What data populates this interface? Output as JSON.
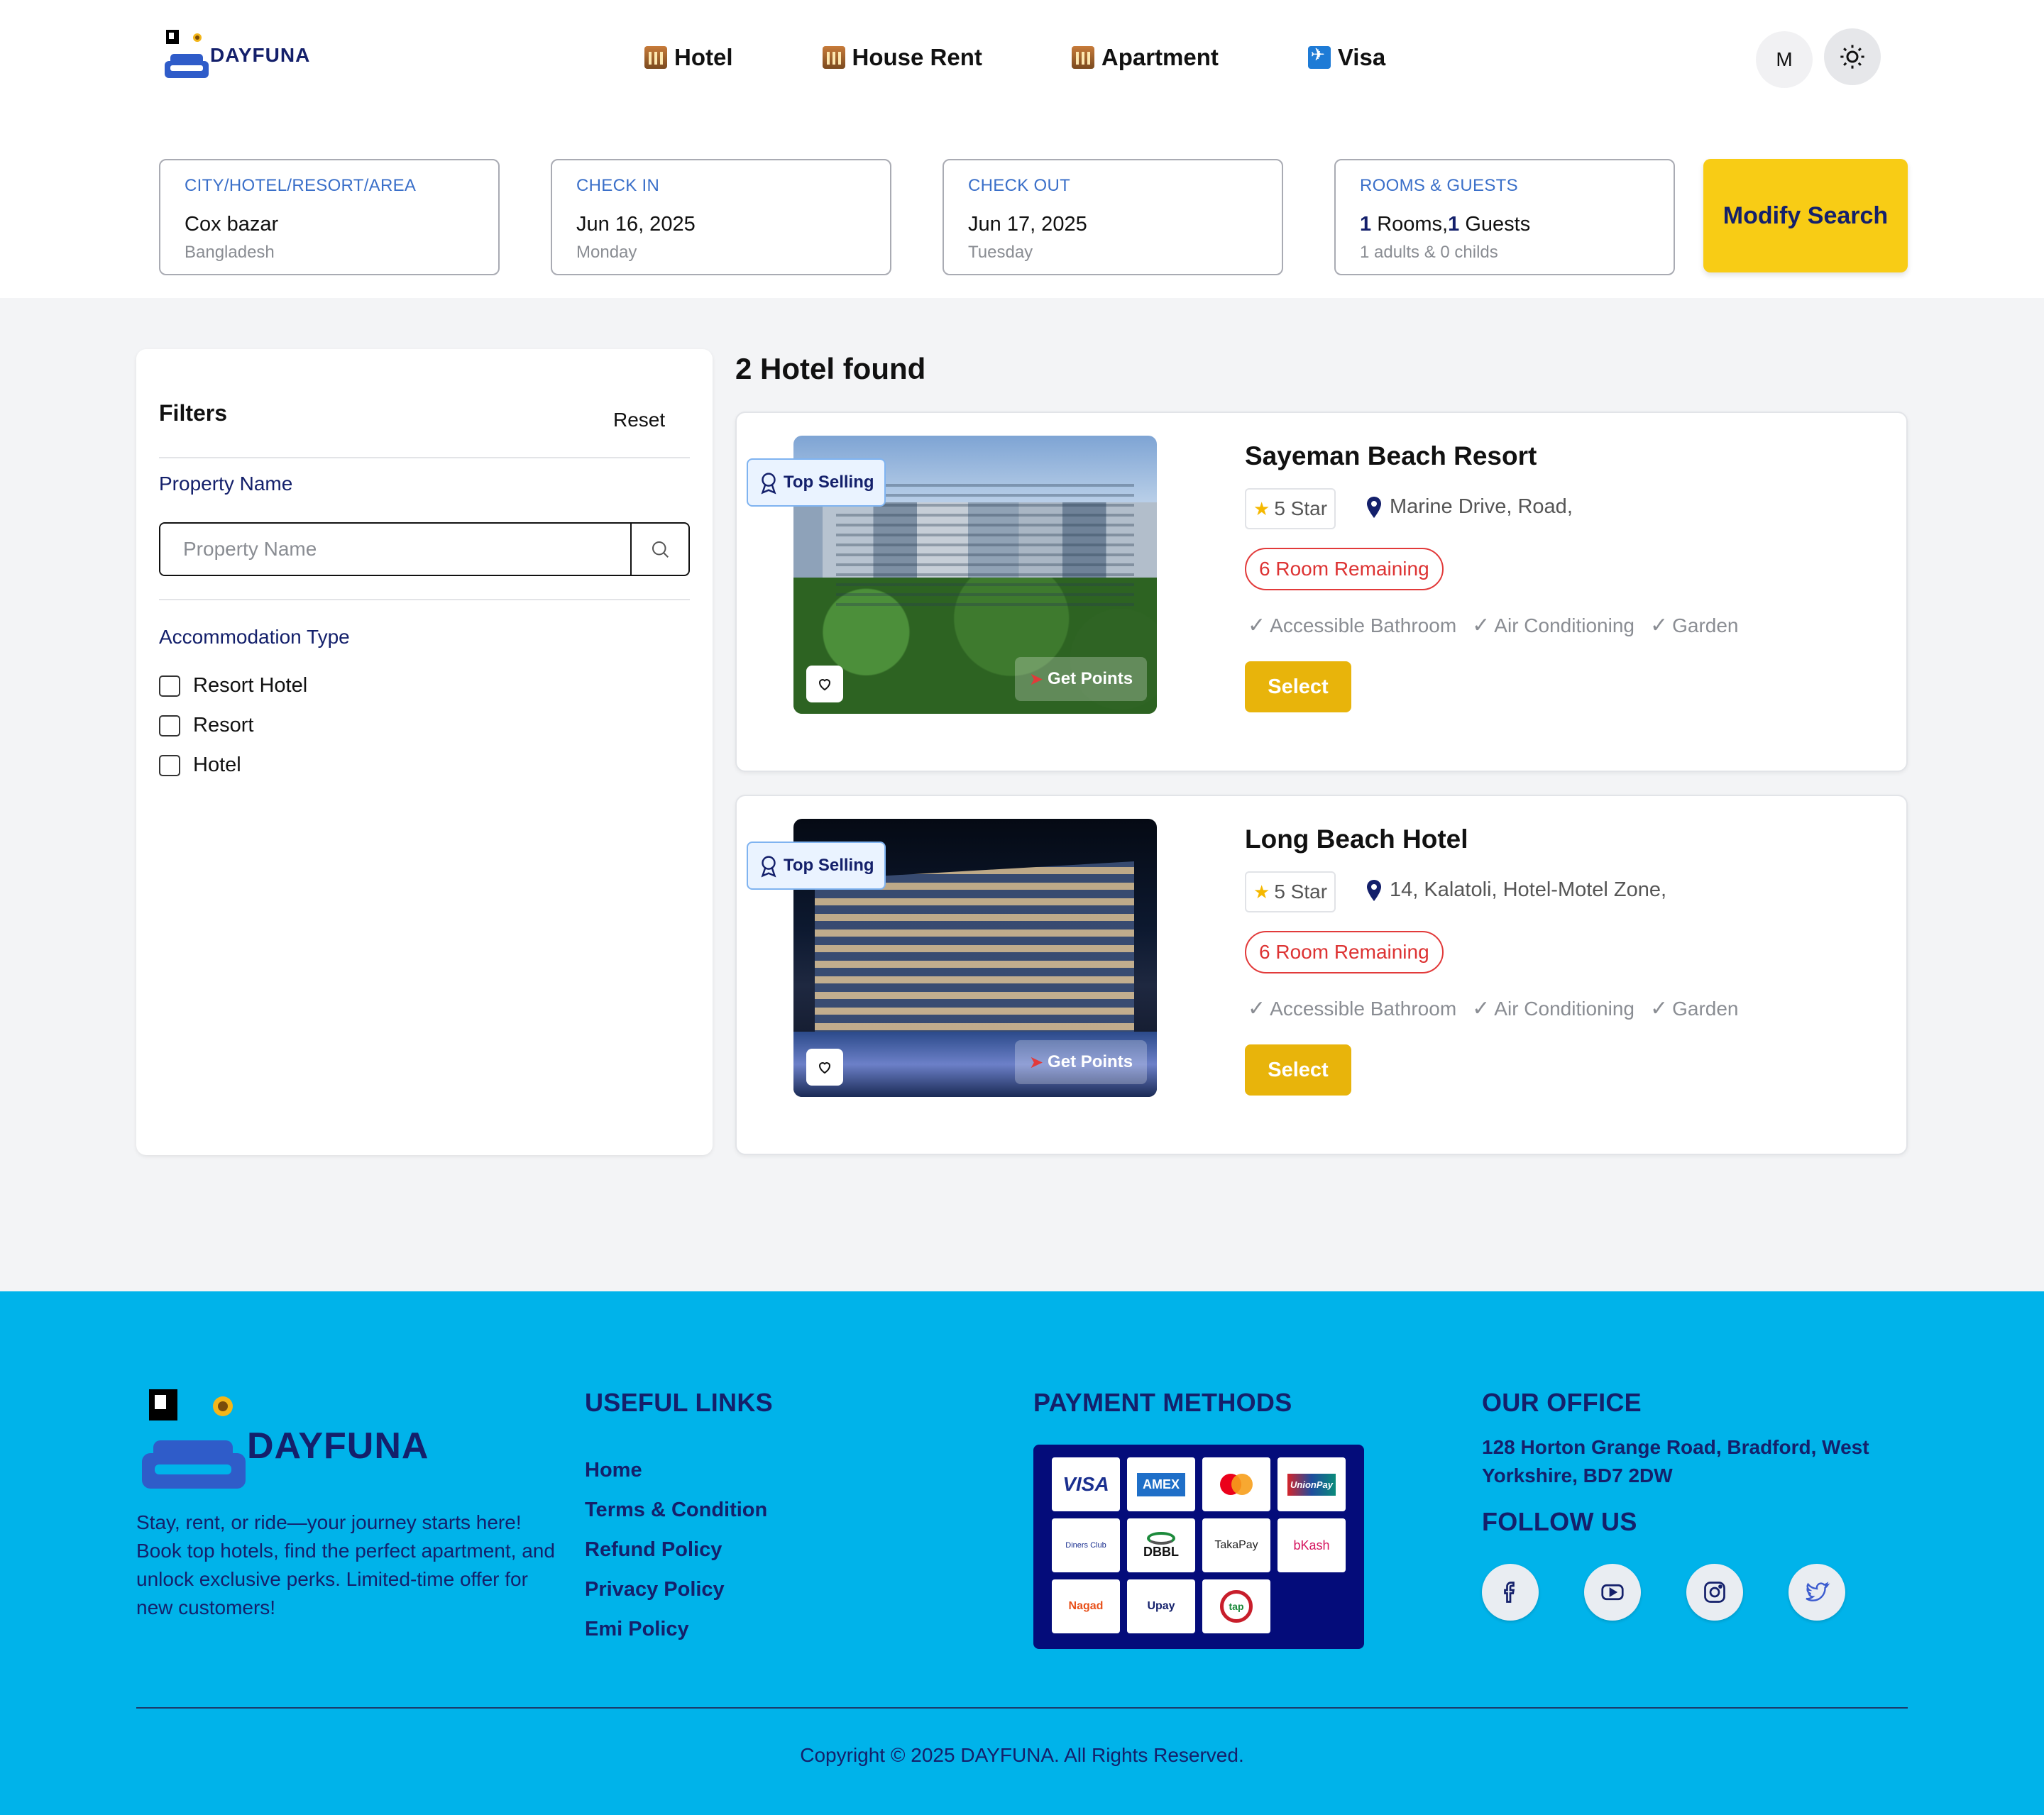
{
  "brand": {
    "name": "DAYFUNA"
  },
  "nav": {
    "items": [
      {
        "label": "Hotel",
        "icon": "hotel-icon"
      },
      {
        "label": "House Rent",
        "icon": "hotel-icon"
      },
      {
        "label": "Apartment",
        "icon": "hotel-icon"
      },
      {
        "label": "Visa",
        "icon": "plane-icon"
      }
    ],
    "avatar_initial": "M",
    "theme_icon": "sun-icon"
  },
  "search": {
    "location": {
      "label": "CITY/HOTEL/RESORT/AREA",
      "value": "Cox bazar",
      "sub": "Bangladesh"
    },
    "checkin": {
      "label": "CHECK IN",
      "value": "Jun 16, 2025",
      "sub": "Monday"
    },
    "checkout": {
      "label": "CHECK OUT",
      "value": "Jun 17, 2025",
      "sub": "Tuesday"
    },
    "rooms": {
      "label": "ROOMS & GUESTS",
      "rooms_count": "1",
      "rooms_text": " Rooms,",
      "guests_count": "1",
      "guests_text": " Guests",
      "sub": "1 adults & 0 childs"
    },
    "modify_label": "Modify Search"
  },
  "filters": {
    "title": "Filters",
    "reset_label": "Reset",
    "property_name_heading": "Property Name",
    "property_name_placeholder": "Property Name",
    "accommodation_heading": "Accommodation Type",
    "accommodation_options": [
      "Resort Hotel",
      "Resort",
      "Hotel"
    ]
  },
  "results": {
    "count_text": "2 Hotel found",
    "hotels": [
      {
        "name": "Sayeman Beach Resort",
        "badge": "Top Selling",
        "stars": "5 Star",
        "location": "Marine Drive, Road,",
        "rooms_remaining": "6 Room Remaining",
        "amenities": [
          "Accessible Bathroom",
          "Air Conditioning",
          "Garden"
        ],
        "points_label": "Get Points",
        "select_label": "Select"
      },
      {
        "name": "Long Beach Hotel",
        "badge": "Top Selling",
        "stars": "5 Star",
        "location": "14, Kalatoli, Hotel-Motel Zone,",
        "rooms_remaining": "6 Room Remaining",
        "amenities": [
          "Accessible Bathroom",
          "Air Conditioning",
          "Garden"
        ],
        "points_label": "Get Points",
        "select_label": "Select"
      }
    ]
  },
  "footer": {
    "description": "Stay, rent, or ride—your journey starts here! Book top hotels, find the perfect apartment, and unlock exclusive perks. Limited-time offer for new customers!",
    "useful_links_heading": "USEFUL LINKS",
    "links": [
      "Home",
      "Terms & Condition",
      "Refund Policy",
      "Privacy Policy",
      "Emi Policy"
    ],
    "payment_heading": "PAYMENT METHODS",
    "payment_methods": [
      "VISA",
      "AMEX",
      "Mastercard",
      "UnionPay",
      "Diners Club",
      "DBBL",
      "TakaPay",
      "bKash",
      "Nagad",
      "Upay",
      "tap"
    ],
    "office_heading": "OUR OFFICE",
    "office_address": "128 Horton Grange Road, Bradford, West Yorkshire, BD7 2DW",
    "follow_heading": "FOLLOW US",
    "social": [
      "facebook-icon",
      "youtube-icon",
      "instagram-icon",
      "twitter-icon"
    ],
    "copyright": "Copyright © 2025 DAYFUNA. All Rights Reserved."
  },
  "colors": {
    "accent_yellow": "#f8cc15",
    "select_yellow": "#e8b40b",
    "navy": "#14206b",
    "footer_bg": "#00b3ea",
    "label_blue": "#3a6fc9",
    "danger": "#e23a3a"
  }
}
